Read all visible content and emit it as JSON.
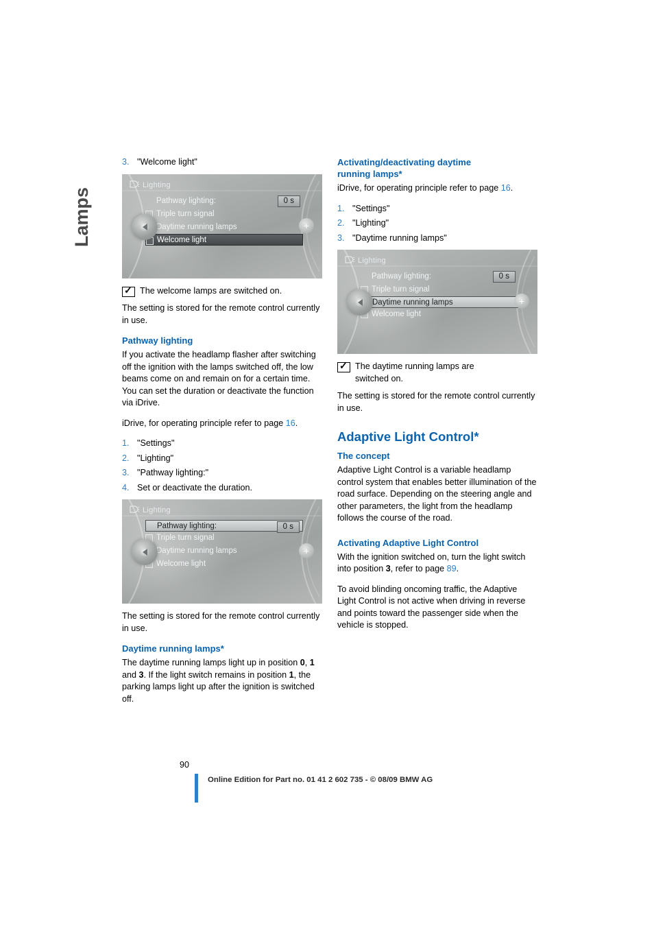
{
  "chapter": "Lamps",
  "page_number": "90",
  "footer": "Online Edition for Part no. 01 41 2 602 735 - © 08/09 BMW AG",
  "colors": {
    "heading_blue": "#0b63ad",
    "link_blue": "#2f7fc6",
    "folio_bar": "#2f7fc6"
  },
  "left_column": {
    "item3_num": "3.",
    "item3_text": "\"Welcome light\"",
    "screen1": {
      "title": "Lighting",
      "rows": [
        {
          "label": "Pathway lighting:",
          "value": "0 s",
          "style": "plain",
          "checkbox": false
        },
        {
          "label": "Triple turn signal",
          "style": "plain",
          "checkbox": true
        },
        {
          "label": "Daytime running lamps",
          "style": "plain",
          "checkbox": true
        },
        {
          "label": "Welcome light",
          "style": "highlight",
          "checkbox": true
        }
      ]
    },
    "note1": "The welcome lamps are switched on.",
    "para1": "The setting is stored for the remote control currently in use.",
    "pathway_heading": "Pathway lighting",
    "pathway_para": "If you activate the headlamp flasher after switching off the ignition with the lamps switched off, the low beams come on and remain on for a certain time. You can set the duration or deactivate the function via iDrive.",
    "idrive_line_pre": "iDrive, for operating principle refer to page ",
    "idrive_page": "16",
    "idrive_line_post": ".",
    "steps": [
      {
        "num": "1.",
        "text": "\"Settings\""
      },
      {
        "num": "2.",
        "text": "\"Lighting\""
      },
      {
        "num": "3.",
        "text": "\"Pathway lighting:\""
      },
      {
        "num": "4.",
        "text": "Set or deactivate the duration."
      }
    ],
    "screen2": {
      "title": "Lighting",
      "rows": [
        {
          "label": "Pathway lighting:",
          "value": "0 s",
          "style": "selected",
          "checkbox": false
        },
        {
          "label": "Triple turn signal",
          "style": "plain",
          "checkbox": true
        },
        {
          "label": "Daytime running lamps",
          "style": "plain",
          "checkbox": true
        },
        {
          "label": "Welcome light",
          "style": "plain",
          "checkbox": true
        }
      ]
    },
    "para2": "The setting is stored for the remote control currently in use.",
    "daytime_heading": "Daytime running lamps*",
    "daytime_para_1": "The daytime running lamps light up in position ",
    "daytime_b0": "0",
    "daytime_para_2": ", ",
    "daytime_b1": "1",
    "daytime_para_3": " and ",
    "daytime_b3": "3",
    "daytime_para_4": ". If the light switch remains in position ",
    "daytime_b1b": "1",
    "daytime_para_5": ", the parking lamps light up after the ignition is switched off."
  },
  "right_column": {
    "activating_heading_line1": "Activating/deactivating daytime",
    "activating_heading_line2": "running lamps*",
    "idrive_line_pre": "iDrive, for operating principle refer to page ",
    "idrive_page": "16",
    "idrive_line_post": ".",
    "steps": [
      {
        "num": "1.",
        "text": "\"Settings\""
      },
      {
        "num": "2.",
        "text": "\"Lighting\""
      },
      {
        "num": "3.",
        "text": "\"Daytime running lamps\""
      }
    ],
    "screen3": {
      "title": "Lighting",
      "rows": [
        {
          "label": "Pathway lighting:",
          "value": "0 s",
          "style": "plain",
          "checkbox": false
        },
        {
          "label": "Triple turn signal",
          "style": "plain",
          "checkbox": true
        },
        {
          "label": "Daytime running lamps",
          "style": "selected",
          "checkbox": true
        },
        {
          "label": "Welcome light",
          "style": "plain",
          "checkbox": true
        }
      ]
    },
    "note1_line1": "The daytime running lamps are",
    "note1_line2": "switched on.",
    "para1": "The setting is stored for the remote control currently in use.",
    "adaptive_heading": "Adaptive Light Control*",
    "concept_heading": "The concept",
    "concept_para": "Adaptive Light Control is a variable headlamp control system that enables better illumination of the road surface. Depending on the steering angle and other parameters, the light from the headlamp follows the course of the road.",
    "activating_alc_heading": "Activating Adaptive Light Control",
    "alc_para1_pre": "With the ignition switched on, turn the light switch into position ",
    "alc_para1_bold": "3",
    "alc_para1_mid": ", refer to page ",
    "alc_para1_page": "89",
    "alc_para1_post": ".",
    "alc_para2": "To avoid blinding oncoming traffic, the Adaptive Light Control is not active when driving in reverse and points toward the passenger side when the vehicle is stopped."
  }
}
